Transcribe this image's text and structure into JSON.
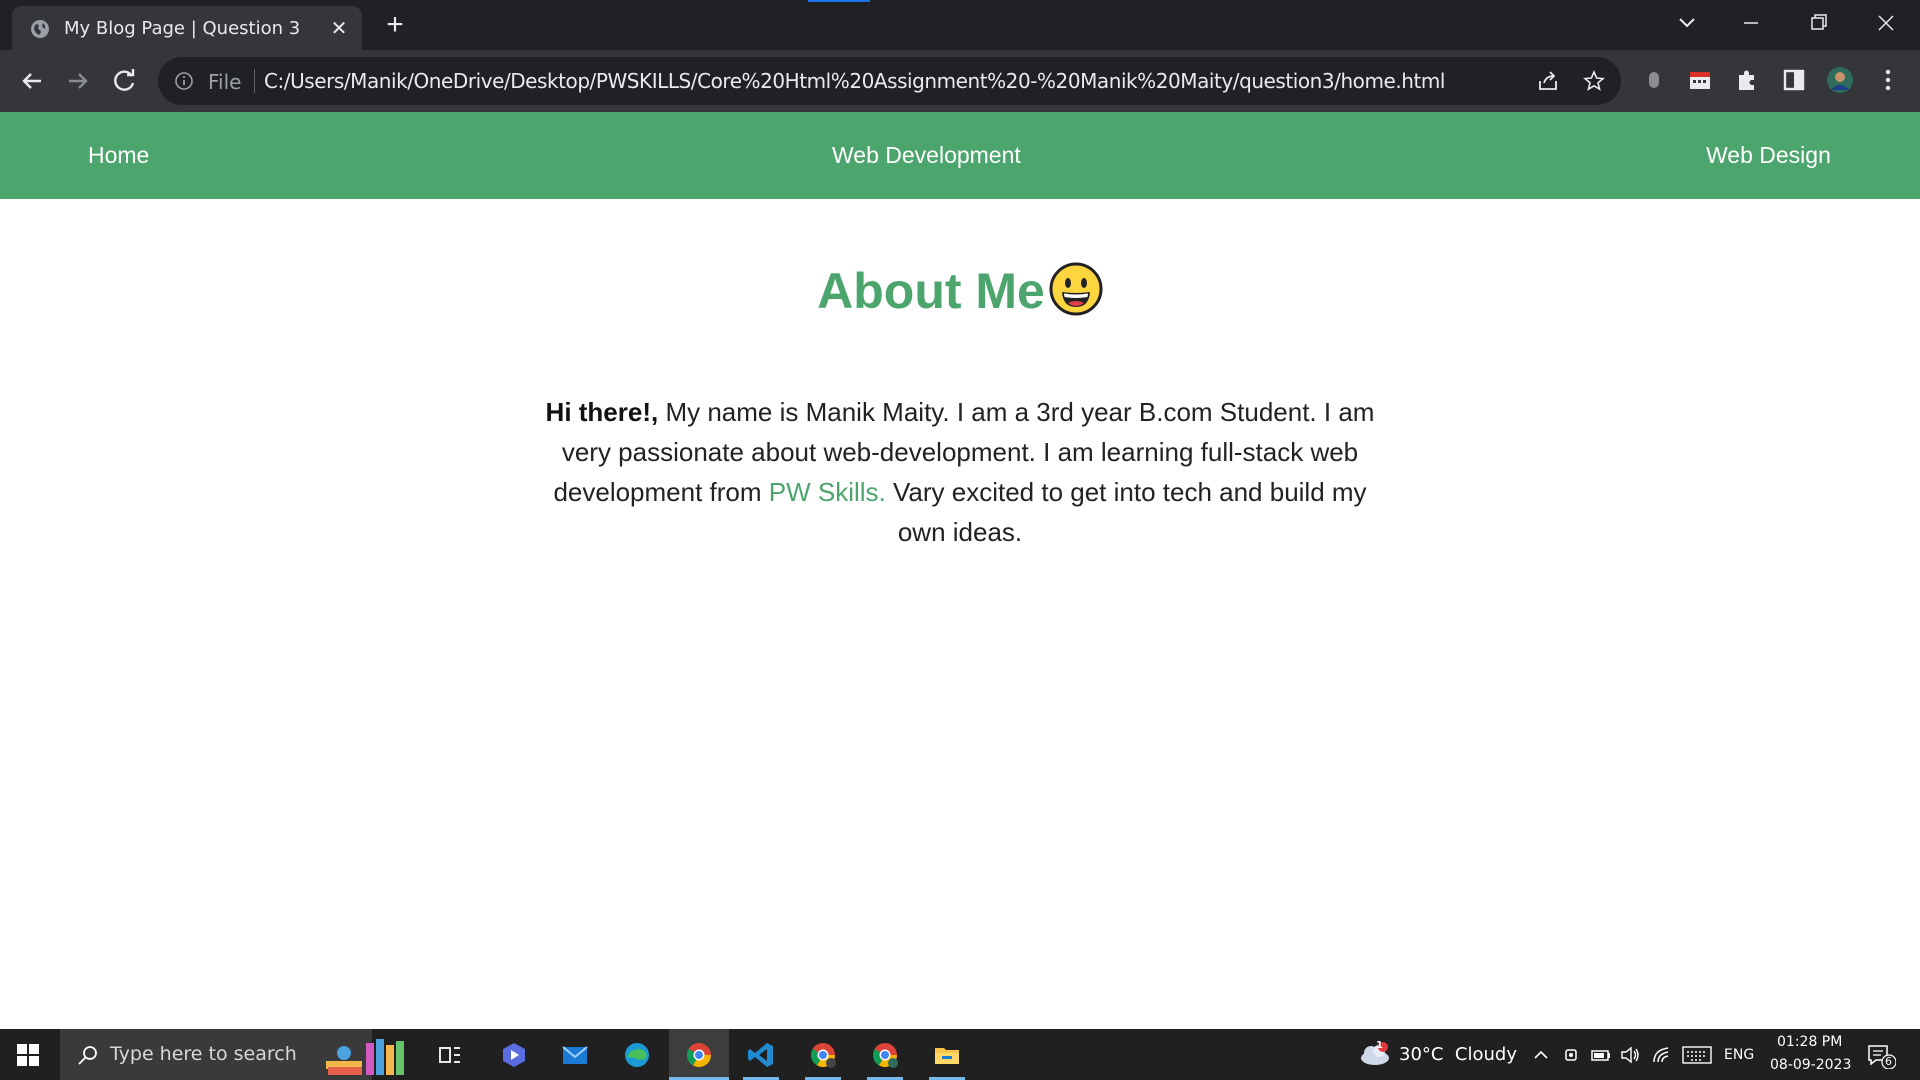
{
  "browser": {
    "tab_title": "My Blog Page | Question 3",
    "tab_close": "✕",
    "new_tab": "+",
    "file_label": "File",
    "url": "C:/Users/Manik/OneDrive/Desktop/PWSKILLS/Core%20Html%20Assignment%20-%20Manik%20Maity/question3/home.html"
  },
  "nav": {
    "home": "Home",
    "web_development": "Web Development",
    "web_design": "Web Design"
  },
  "about": {
    "title": "About Me",
    "emoji": "smiling-face-icon",
    "greeting": "Hi there!,",
    "text_1": " My name is Manik Maity. I am a 3rd year B.com Student. I am very passionate about web-development. I am learning full-stack web development from ",
    "link": "PW Skills.",
    "text_2": " Vary excited to get into tech and build my own ideas."
  },
  "taskbar": {
    "search_placeholder": "Type here to search",
    "weather": "30°C  Cloudy",
    "weather_badge": "1",
    "language": "ENG",
    "time": "01:28 PM",
    "date": "08-09-2023",
    "notifications": "6"
  },
  "colors": {
    "accent_green": "#4ca56d",
    "chrome_dark": "#202124",
    "chrome_toolbar": "#35363a"
  }
}
